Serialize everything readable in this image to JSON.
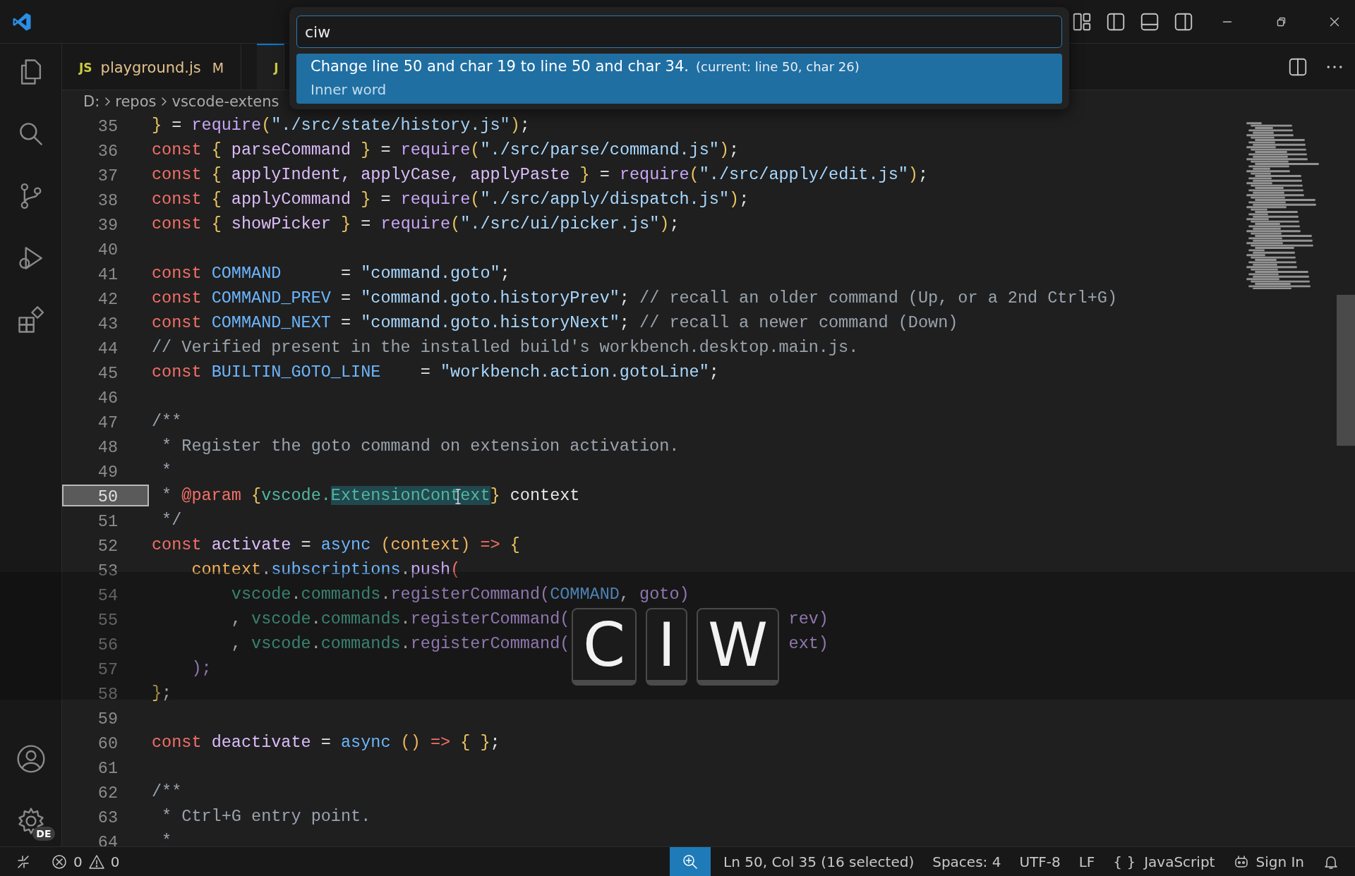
{
  "tabs": [
    {
      "icon": "JS",
      "label": "playground.js",
      "badge": "M",
      "selected": false
    },
    {
      "icon": "J",
      "selected": true
    }
  ],
  "breadcrumbs": [
    "D:",
    "repos",
    "vscode-extens"
  ],
  "quick_pick": {
    "value": "ciw",
    "items": [
      {
        "label": "Change line 50 and char 19 to line 50 and char 34.",
        "description": "(current: line 50, char 26)",
        "detail": "Inner word",
        "selected": true
      }
    ]
  },
  "editor": {
    "lines": [
      {
        "number": "35",
        "current": false,
        "tokens": [
          {
            "text": "} ",
            "kind": "brace"
          },
          {
            "text": "= ",
            "kind": "plain"
          },
          {
            "text": "require",
            "kind": "fn"
          },
          {
            "text": "(",
            "kind": "brace"
          },
          {
            "text": "\"./src/state/history.js\"",
            "kind": "str"
          },
          {
            "text": ")",
            "kind": "brace"
          },
          {
            "text": ";",
            "kind": "plain"
          }
        ]
      },
      {
        "number": "36",
        "current": false,
        "tokens": [
          {
            "text": "const ",
            "kind": "kw"
          },
          {
            "text": "{ ",
            "kind": "brace"
          },
          {
            "text": "parseCommand ",
            "kind": "var"
          },
          {
            "text": "} ",
            "kind": "brace"
          },
          {
            "text": "= ",
            "kind": "plain"
          },
          {
            "text": "require",
            "kind": "fn"
          },
          {
            "text": "(",
            "kind": "brace"
          },
          {
            "text": "\"./src/parse/command.js\"",
            "kind": "str"
          },
          {
            "text": ")",
            "kind": "brace"
          },
          {
            "text": ";",
            "kind": "plain"
          }
        ]
      },
      {
        "number": "37",
        "current": false,
        "tokens": [
          {
            "text": "const ",
            "kind": "kw"
          },
          {
            "text": "{ ",
            "kind": "brace"
          },
          {
            "text": "applyIndent, applyCase, applyPaste ",
            "kind": "var"
          },
          {
            "text": "} ",
            "kind": "brace"
          },
          {
            "text": "= ",
            "kind": "plain"
          },
          {
            "text": "require",
            "kind": "fn"
          },
          {
            "text": "(",
            "kind": "brace"
          },
          {
            "text": "\"./src/apply/edit.js\"",
            "kind": "str"
          },
          {
            "text": ")",
            "kind": "brace"
          },
          {
            "text": ";",
            "kind": "plain"
          }
        ]
      },
      {
        "number": "38",
        "current": false,
        "tokens": [
          {
            "text": "const ",
            "kind": "kw"
          },
          {
            "text": "{ ",
            "kind": "brace"
          },
          {
            "text": "applyCommand ",
            "kind": "var"
          },
          {
            "text": "} ",
            "kind": "brace"
          },
          {
            "text": "= ",
            "kind": "plain"
          },
          {
            "text": "require",
            "kind": "fn"
          },
          {
            "text": "(",
            "kind": "brace"
          },
          {
            "text": "\"./src/apply/dispatch.js\"",
            "kind": "str"
          },
          {
            "text": ")",
            "kind": "brace"
          },
          {
            "text": ";",
            "kind": "plain"
          }
        ]
      },
      {
        "number": "39",
        "current": false,
        "tokens": [
          {
            "text": "const ",
            "kind": "kw"
          },
          {
            "text": "{ ",
            "kind": "brace"
          },
          {
            "text": "showPicker ",
            "kind": "var"
          },
          {
            "text": "} ",
            "kind": "brace"
          },
          {
            "text": "= ",
            "kind": "plain"
          },
          {
            "text": "require",
            "kind": "fn"
          },
          {
            "text": "(",
            "kind": "brace"
          },
          {
            "text": "\"./src/ui/picker.js\"",
            "kind": "str"
          },
          {
            "text": ")",
            "kind": "brace"
          },
          {
            "text": ";",
            "kind": "plain"
          }
        ]
      },
      {
        "number": "40",
        "current": false
      },
      {
        "number": "41",
        "current": false,
        "tokens": [
          {
            "text": "const ",
            "kind": "kw"
          },
          {
            "text": "COMMAND      ",
            "kind": "const"
          },
          {
            "text": "= ",
            "kind": "plain"
          },
          {
            "text": "\"command.goto\"",
            "kind": "str"
          },
          {
            "text": ";",
            "kind": "plain"
          }
        ]
      },
      {
        "number": "42",
        "current": false,
        "tokens": [
          {
            "text": "const ",
            "kind": "kw"
          },
          {
            "text": "COMMAND_PREV ",
            "kind": "const"
          },
          {
            "text": "= ",
            "kind": "plain"
          },
          {
            "text": "\"command.goto.historyPrev\"",
            "kind": "str"
          },
          {
            "text": "; ",
            "kind": "plain"
          },
          {
            "text": "// recall an older command (Up, or a 2nd Ctrl+G)",
            "kind": "com"
          }
        ]
      },
      {
        "number": "43",
        "current": false,
        "tokens": [
          {
            "text": "const ",
            "kind": "kw"
          },
          {
            "text": "COMMAND_NEXT ",
            "kind": "const"
          },
          {
            "text": "= ",
            "kind": "plain"
          },
          {
            "text": "\"command.goto.historyNext\"",
            "kind": "str"
          },
          {
            "text": "; ",
            "kind": "plain"
          },
          {
            "text": "// recall a newer command (Down)",
            "kind": "com"
          }
        ]
      },
      {
        "number": "44",
        "current": false,
        "tokens": [
          {
            "text": "// Verified present in the installed build's workbench.desktop.main.js.",
            "kind": "com"
          }
        ]
      },
      {
        "number": "45",
        "current": false,
        "tokens": [
          {
            "text": "const ",
            "kind": "kw"
          },
          {
            "text": "BUILTIN_GOTO_LINE    ",
            "kind": "const"
          },
          {
            "text": "= ",
            "kind": "plain"
          },
          {
            "text": "\"workbench.action.gotoLine\"",
            "kind": "str"
          },
          {
            "text": ";",
            "kind": "plain"
          }
        ]
      },
      {
        "number": "46",
        "current": false
      },
      {
        "number": "47",
        "current": false,
        "tokens": [
          {
            "text": "/**",
            "kind": "com"
          }
        ]
      },
      {
        "number": "48",
        "current": false,
        "tokens": [
          {
            "text": " * Register the goto command on extension activation.",
            "kind": "com"
          }
        ]
      },
      {
        "number": "49",
        "current": false,
        "tokens": [
          {
            "text": " *",
            "kind": "com"
          }
        ]
      },
      {
        "number": "50",
        "current": true,
        "tokens": [
          {
            "text": " * ",
            "kind": "com"
          },
          {
            "text": "@param ",
            "kind": "kw"
          },
          {
            "text": "{",
            "kind": "brace"
          },
          {
            "text": "vscode.",
            "kind": "type"
          },
          {
            "text": "ExtensionContext",
            "kind": "sel"
          },
          {
            "text": "} ",
            "kind": "brace"
          },
          {
            "text": "context",
            "kind": "plain"
          }
        ]
      },
      {
        "number": "51",
        "current": false,
        "tokens": [
          {
            "text": " */",
            "kind": "com"
          }
        ]
      },
      {
        "number": "52",
        "current": false,
        "tokens": [
          {
            "text": "const ",
            "kind": "kw"
          },
          {
            "text": "activate ",
            "kind": "var"
          },
          {
            "text": "= ",
            "kind": "plain"
          },
          {
            "text": "async ",
            "kind": "const"
          },
          {
            "text": "(context) ",
            "kind": "param"
          },
          {
            "text": "=> ",
            "kind": "kw"
          },
          {
            "text": "{",
            "kind": "brace"
          }
        ]
      },
      {
        "number": "53",
        "current": false,
        "tokens": [
          {
            "text": "    context",
            "kind": "param"
          },
          {
            "text": ".",
            "kind": "plain"
          },
          {
            "text": "subscriptions",
            "kind": "const"
          },
          {
            "text": ".",
            "kind": "plain"
          },
          {
            "text": "push",
            "kind": "fn"
          },
          {
            "text": "(",
            "kind": "kw"
          }
        ]
      },
      {
        "number": "54",
        "current": false,
        "tokens": [
          {
            "text": "        vscode",
            "kind": "type"
          },
          {
            "text": ".",
            "kind": "plain"
          },
          {
            "text": "commands",
            "kind": "type"
          },
          {
            "text": ".",
            "kind": "plain"
          },
          {
            "text": "registerCommand",
            "kind": "fn"
          },
          {
            "text": "(",
            "kind": "fn"
          },
          {
            "text": "COMMAND",
            "kind": "const"
          },
          {
            "text": ", ",
            "kind": "plain"
          },
          {
            "text": "goto",
            "kind": "fn"
          },
          {
            "text": ")",
            "kind": "fn"
          }
        ]
      },
      {
        "number": "55",
        "current": false,
        "tokens": [
          {
            "text": "        , ",
            "kind": "plain"
          },
          {
            "text": "vscode",
            "kind": "type"
          },
          {
            "text": ".",
            "kind": "plain"
          },
          {
            "text": "commands",
            "kind": "type"
          },
          {
            "text": ".",
            "kind": "plain"
          },
          {
            "text": "registerCommand",
            "kind": "fn"
          },
          {
            "text": "(",
            "kind": "fn"
          }
        ],
        "tail": [
          {
            "text": "rev",
            "kind": "fn"
          },
          {
            "text": ")",
            "kind": "fn"
          }
        ]
      },
      {
        "number": "56",
        "current": false,
        "tokens": [
          {
            "text": "        , ",
            "kind": "plain"
          },
          {
            "text": "vscode",
            "kind": "type"
          },
          {
            "text": ".",
            "kind": "plain"
          },
          {
            "text": "commands",
            "kind": "type"
          },
          {
            "text": ".",
            "kind": "plain"
          },
          {
            "text": "registerCommand",
            "kind": "fn"
          },
          {
            "text": "(",
            "kind": "fn"
          }
        ],
        "tail": [
          {
            "text": "ext",
            "kind": "fn"
          },
          {
            "text": ")",
            "kind": "fn"
          }
        ]
      },
      {
        "number": "57",
        "current": false,
        "tokens": [
          {
            "text": "    );",
            "kind": "fn"
          }
        ]
      },
      {
        "number": "58",
        "current": false,
        "tokens": [
          {
            "text": "}",
            "kind": "brace"
          },
          {
            "text": ";",
            "kind": "plain"
          }
        ]
      },
      {
        "number": "59",
        "current": false
      },
      {
        "number": "60",
        "current": false,
        "tokens": [
          {
            "text": "const ",
            "kind": "kw"
          },
          {
            "text": "deactivate ",
            "kind": "var"
          },
          {
            "text": "= ",
            "kind": "plain"
          },
          {
            "text": "async ",
            "kind": "const"
          },
          {
            "text": "() ",
            "kind": "param"
          },
          {
            "text": "=> ",
            "kind": "kw"
          },
          {
            "text": "{ }",
            "kind": "brace"
          },
          {
            "text": ";",
            "kind": "plain"
          }
        ]
      },
      {
        "number": "61",
        "current": false
      },
      {
        "number": "62",
        "current": false,
        "tokens": [
          {
            "text": "/**",
            "kind": "com"
          }
        ]
      },
      {
        "number": "63",
        "current": false,
        "tokens": [
          {
            "text": " * Ctrl+G entry point.",
            "kind": "com"
          }
        ]
      },
      {
        "number": "64",
        "current": false,
        "tokens": [
          {
            "text": " *",
            "kind": "com"
          }
        ]
      }
    ]
  },
  "keycast": {
    "keys": [
      "C",
      "I",
      "W"
    ]
  },
  "account_badge": "DE",
  "status_bar": {
    "errors": "0",
    "warnings": "0",
    "position": "Ln 50, Col 35 (16 selected)",
    "spaces": "Spaces: 4",
    "encoding": "UTF-8",
    "eol": "LF",
    "language_glyph": "{ }",
    "language": "JavaScript",
    "sign_in": "Sign In"
  }
}
